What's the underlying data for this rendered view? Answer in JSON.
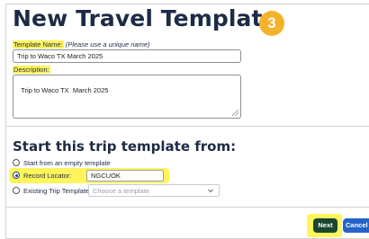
{
  "page": {
    "title": "New Travel Template",
    "step_badge": "3"
  },
  "template_name": {
    "label": "Template Name:",
    "hint": "(Please use a unique name)",
    "value": "Trip to Waco TX  March 2025"
  },
  "description": {
    "label": "Description:",
    "value": "Trip to Waco TX  March 2025"
  },
  "start_from": {
    "heading": "Start this trip template from:",
    "options": [
      {
        "label": "Start from an empty template",
        "checked": false
      },
      {
        "label": "Record Locator:",
        "checked": true,
        "value": "NGCUOK"
      },
      {
        "label": "Existing Trip Template:",
        "checked": false,
        "placeholder": "Choose a template"
      }
    ]
  },
  "buttons": {
    "next": "Next",
    "cancel": "Cancel"
  },
  "colors": {
    "highlight": "#fff45c",
    "badge": "#f3b229",
    "next_button": "#1a4630",
    "cancel_button": "#2563c9"
  }
}
